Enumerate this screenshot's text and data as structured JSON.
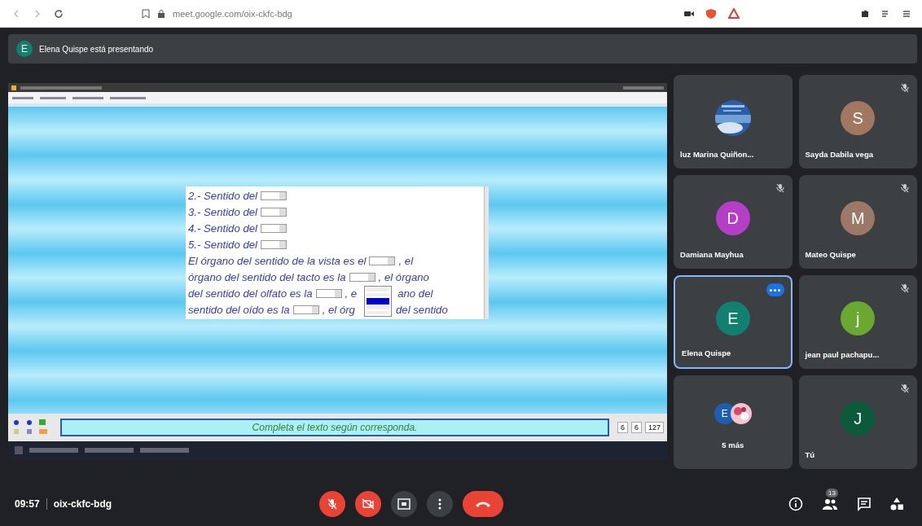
{
  "browser": {
    "url": "meet.google.com/oix-ckfc-bdg"
  },
  "banner": {
    "initial": "E",
    "text": "Elena Quispe está presentando"
  },
  "shared_screen": {
    "exercise": [
      {
        "parts": [
          {
            "kind": "text",
            "text": "2.-  Sentido del"
          },
          {
            "kind": "select"
          }
        ]
      },
      {
        "parts": [
          {
            "kind": "text",
            "text": "3.-  Sentido del"
          },
          {
            "kind": "select"
          }
        ]
      },
      {
        "parts": [
          {
            "kind": "text",
            "text": "4.-  Sentido del"
          },
          {
            "kind": "select"
          }
        ]
      },
      {
        "parts": [
          {
            "kind": "text",
            "text": "5.-  Sentido  del"
          },
          {
            "kind": "select"
          }
        ]
      },
      {
        "parts": [
          {
            "kind": "text",
            "text": "El órgano del sentido de la vista es el"
          },
          {
            "kind": "select"
          },
          {
            "kind": "text",
            "text": ", el"
          }
        ]
      },
      {
        "parts": [
          {
            "kind": "text",
            "text": "órgano del sentido del tacto es la"
          },
          {
            "kind": "select"
          },
          {
            "kind": "text",
            "text": ", el órgano"
          }
        ]
      },
      {
        "parts": [
          {
            "kind": "text",
            "text": "del sentido del olfato es la"
          },
          {
            "kind": "select"
          },
          {
            "kind": "text",
            "text": ", e"
          },
          {
            "kind": "gap",
            "dropdown": true
          },
          {
            "kind": "text",
            "text": "ano del"
          }
        ]
      },
      {
        "parts": [
          {
            "kind": "text",
            "text": "sentido del  oído es la"
          },
          {
            "kind": "select"
          },
          {
            "kind": "text",
            "text": ", el órg"
          },
          {
            "kind": "gap"
          },
          {
            "kind": "text",
            "text": "del sentido"
          }
        ]
      }
    ],
    "dropdown_options": [
      {
        "selected": false
      },
      {
        "selected": false
      },
      {
        "selected": true
      },
      {
        "selected": false
      },
      {
        "selected": false
      }
    ],
    "instruction": "Completa el texto según corresponda.",
    "counters": [
      "6",
      "6",
      "127"
    ]
  },
  "participants": [
    {
      "name": "luz Marina Quiñon...",
      "muted": false,
      "selected": false,
      "speaking": false
    },
    {
      "name": "Sayda Dabila vega",
      "kind": "avatar",
      "initial": "S",
      "color": "#a1775f",
      "muted": true,
      "selected": false,
      "speaking": false
    },
    {
      "name": "Damiana Mayhua",
      "kind": "avatar",
      "initial": "D",
      "color": "#b43fc6",
      "muted": true,
      "selected": false,
      "speaking": false
    },
    {
      "name": "Mateo Quispe",
      "kind": "avatar",
      "initial": "M",
      "color": "#9c7866",
      "muted": true,
      "selected": false,
      "speaking": false
    },
    {
      "name": "Elena Quispe",
      "kind": "avatar",
      "initial": "E",
      "color": "#12806f",
      "muted": false,
      "selected": true,
      "speaking": true
    },
    {
      "name": "jean paul pachapu...",
      "kind": "avatar",
      "initial": "j",
      "color": "#6aa832",
      "muted": true,
      "selected": false,
      "speaking": false
    },
    {
      "name": "5 más",
      "kind": "group",
      "initial": "E",
      "color": "#1a5fb4",
      "muted": false,
      "selected": false,
      "speaking": false
    },
    {
      "name": "Tú",
      "kind": "avatar",
      "initial": "J",
      "color": "#0c5a3c",
      "muted": true,
      "selected": false,
      "speaking": false
    }
  ],
  "footer": {
    "time": "09:57",
    "code": "oix-ckfc-bdg",
    "mic_on": false,
    "camera_on": false,
    "people_count": "13"
  }
}
